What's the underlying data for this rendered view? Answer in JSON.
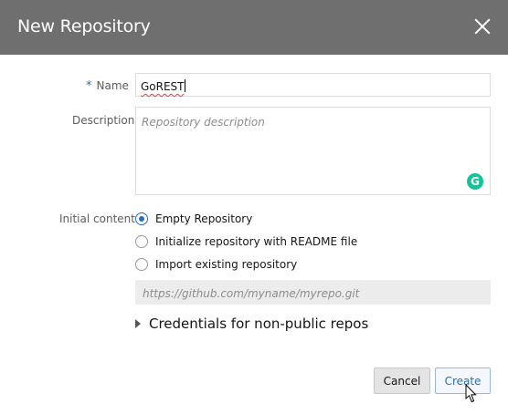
{
  "dialog": {
    "title": "New Repository",
    "close_icon": "close-icon"
  },
  "form": {
    "name": {
      "required_marker": "*",
      "label": "Name",
      "value": "GoREST"
    },
    "description": {
      "label": "Description",
      "placeholder": "Repository description",
      "grammarly_icon": "grammarly-icon",
      "grammarly_glyph": "G"
    },
    "initial_content": {
      "label": "Initial content",
      "options": [
        {
          "label": "Empty Repository",
          "selected": true
        },
        {
          "label": "Initialize repository with README file",
          "selected": false
        },
        {
          "label": "Import existing repository",
          "selected": false
        }
      ],
      "url_placeholder": "https://github.com/myname/myrepo.git"
    },
    "credentials": {
      "label": "Credentials for non-public repos",
      "icon": "triangle-right-icon",
      "expanded": false
    }
  },
  "buttons": {
    "cancel": "Cancel",
    "create": "Create"
  },
  "colors": {
    "titlebar": "#6f6f6f",
    "accent": "#2a6ebb",
    "grammarly": "#15c39a"
  }
}
